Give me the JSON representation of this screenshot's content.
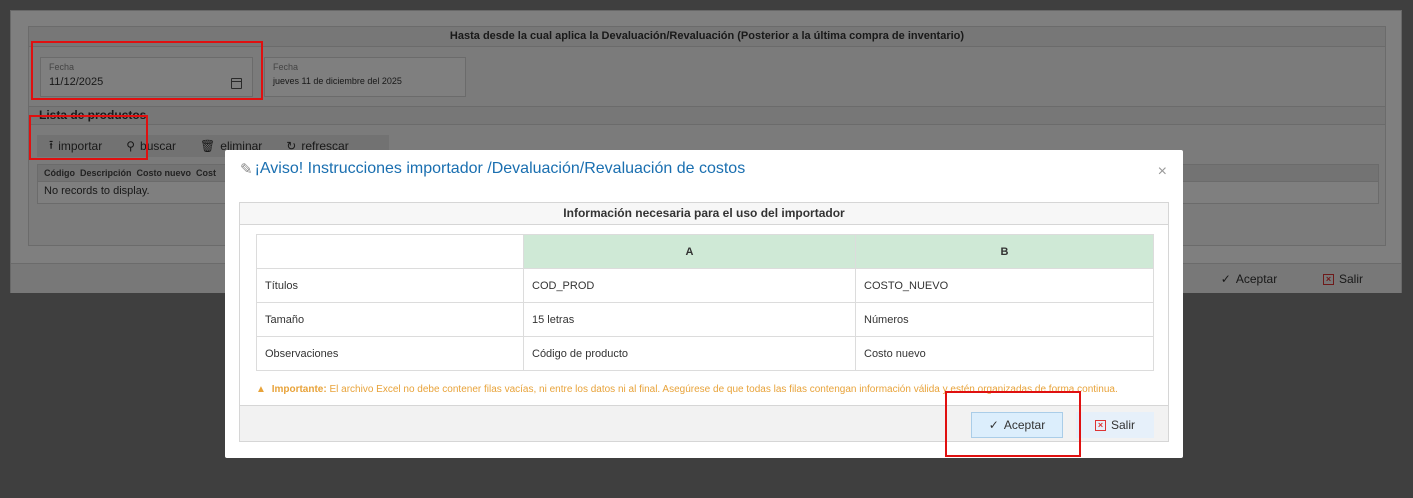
{
  "period": {
    "header": "Hasta desde la cual aplica la Devaluación/Revaluación (Posterior a la última compra de inventario)",
    "date_label": "Fecha",
    "date_value": "11/12/2025",
    "long_date_label": "Fecha",
    "long_date_value": "jueves 11 de diciembre del 2025"
  },
  "products": {
    "title": "Lista de productos",
    "toolbar": {
      "import": "importar",
      "search": "buscar",
      "delete": "eliminar",
      "refresh": "refrescar"
    },
    "columns": [
      "Código",
      "Descripción",
      "Costo nuevo",
      "Cost"
    ],
    "empty": "No records to display."
  },
  "footer": {
    "accept": "Aceptar",
    "exit": "Salir"
  },
  "modal": {
    "title": "¡Aviso! Instrucciones importador /Devaluación/Revaluación de costos",
    "close": "×",
    "section_title": "Información necesaria para el uso del importador",
    "table": {
      "headers": [
        "",
        "A",
        "B"
      ],
      "rows": [
        [
          "Títulos",
          "COD_PROD",
          "COSTO_NUEVO"
        ],
        [
          "Tamaño",
          "15 letras",
          "Números"
        ],
        [
          "Observaciones",
          "Código de producto",
          "Costo nuevo"
        ]
      ]
    },
    "warning_label": "Importante:",
    "warning_text": "El archivo Excel no debe contener filas vacías, ni entre los datos ni al final. Asegúrese de que todas las filas contengan información válida y estén organizadas de forma continua.",
    "accept": "Aceptar",
    "exit": "Salir"
  },
  "colors": {
    "accent": "#1a6fb0",
    "header_green": "#cfe9d6",
    "warning": "#e8a33a",
    "highlight": "#e01010"
  }
}
